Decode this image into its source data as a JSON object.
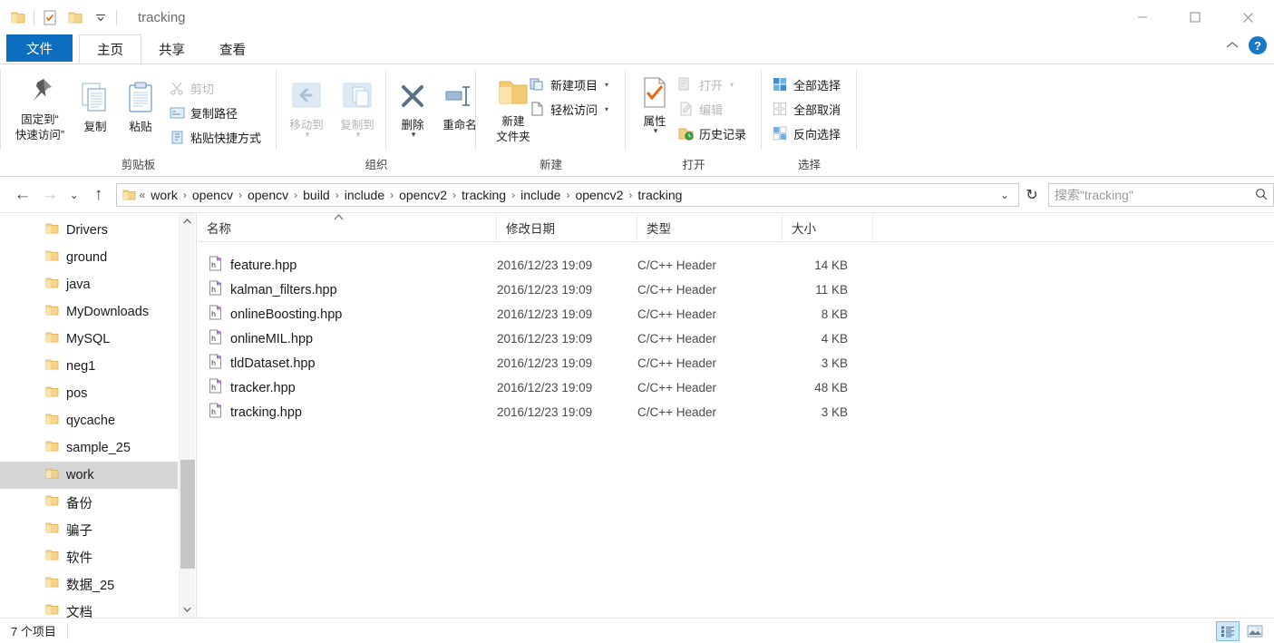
{
  "window": {
    "title": "tracking",
    "minimize_label": "最小化",
    "maximize_label": "最大化",
    "close_label": "关闭"
  },
  "quick_access": {
    "items": [
      {
        "name": "folder-icon",
        "label": "属性"
      },
      {
        "name": "properties-icon",
        "label": "属性"
      },
      {
        "name": "new-folder-icon",
        "label": "新建文件夹"
      },
      {
        "name": "customize-icon",
        "label": "自定义快速访问工具栏"
      }
    ]
  },
  "tabs": [
    {
      "id": "file",
      "label": "文件",
      "state": "file"
    },
    {
      "id": "home",
      "label": "主页",
      "state": "active"
    },
    {
      "id": "share",
      "label": "共享",
      "state": "normal"
    },
    {
      "id": "view",
      "label": "查看",
      "state": "normal"
    }
  ],
  "ribbon_right": {
    "collapse_label": "⌃",
    "help_label": "?"
  },
  "ribbon": {
    "groups": [
      {
        "id": "clipboard",
        "label": "剪贴板",
        "big": [
          {
            "name": "pin-to-quick-access-button",
            "icon": "pin-icon",
            "label": "固定到“\n快速访问”",
            "line1": "固定到“",
            "line2": "快速访问”",
            "dim": false
          },
          {
            "name": "copy-button",
            "icon": "copy-icon",
            "label": "复制",
            "dim": false
          },
          {
            "name": "paste-button",
            "icon": "paste-icon",
            "label": "粘贴",
            "dim": false
          }
        ],
        "small": [
          {
            "name": "cut-button",
            "icon": "scissors-icon",
            "label": "剪切",
            "dim": true
          },
          {
            "name": "copy-path-button",
            "icon": "copy-path-icon",
            "label": "复制路径",
            "dim": false
          },
          {
            "name": "paste-shortcut-button",
            "icon": "paste-shortcut-icon",
            "label": "粘贴快捷方式",
            "dim": false
          }
        ]
      },
      {
        "id": "organize",
        "label": "组织",
        "big": [
          {
            "name": "move-to-button",
            "icon": "move-to-icon",
            "label": "移动到",
            "dim": true
          },
          {
            "name": "copy-to-button",
            "icon": "copy-to-icon",
            "label": "复制到",
            "dim": true
          },
          {
            "name": "delete-button",
            "icon": "delete-icon",
            "label": "删除",
            "dim": false
          },
          {
            "name": "rename-button",
            "icon": "rename-icon",
            "label": "重命名",
            "dim": false
          }
        ],
        "small": []
      },
      {
        "id": "new",
        "label": "新建",
        "big": [
          {
            "name": "new-folder-button",
            "icon": "new-folder-icon",
            "line1": "新建",
            "line2": "文件夹",
            "label": "新建文件夹",
            "dim": false
          }
        ],
        "small": [
          {
            "name": "new-item-button",
            "icon": "new-item-icon",
            "label": "新建项目",
            "dim": false,
            "caret": true
          },
          {
            "name": "easy-access-button",
            "icon": "easy-access-icon",
            "label": "轻松访问",
            "dim": false,
            "caret": true
          }
        ]
      },
      {
        "id": "open",
        "label": "打开",
        "big": [
          {
            "name": "properties-button",
            "icon": "properties-icon",
            "label": "属性",
            "dim": false
          }
        ],
        "small": [
          {
            "name": "open-button",
            "icon": "open-icon",
            "label": "打开",
            "dim": true,
            "caret": true
          },
          {
            "name": "edit-button",
            "icon": "edit-icon",
            "label": "编辑",
            "dim": true
          },
          {
            "name": "history-button",
            "icon": "history-icon",
            "label": "历史记录",
            "dim": false
          }
        ]
      },
      {
        "id": "select",
        "label": "选择",
        "big": [],
        "small": [
          {
            "name": "select-all-button",
            "icon": "select-all-icon",
            "label": "全部选择",
            "dim": false
          },
          {
            "name": "select-none-button",
            "icon": "select-none-icon",
            "label": "全部取消",
            "dim": false
          },
          {
            "name": "invert-selection-button",
            "icon": "invert-selection-icon",
            "label": "反向选择",
            "dim": false
          }
        ]
      }
    ]
  },
  "nav": {
    "back_label": "←",
    "forward_label": "→",
    "recent_label": "⌄",
    "up_label": "↑",
    "overflow_label": "«",
    "breadcrumbs": [
      "work",
      "opencv",
      "opencv",
      "build",
      "include",
      "opencv2",
      "tracking",
      "include",
      "opencv2",
      "tracking"
    ],
    "separator": "›",
    "dropdown_label": "⌄",
    "refresh_label": "↻"
  },
  "search": {
    "placeholder": "搜索\"tracking\"",
    "icon": "search-icon"
  },
  "sidebar": {
    "items": [
      {
        "label": "Drivers",
        "selected": false
      },
      {
        "label": "ground",
        "selected": false
      },
      {
        "label": "java",
        "selected": false
      },
      {
        "label": "MyDownloads",
        "selected": false
      },
      {
        "label": "MySQL",
        "selected": false
      },
      {
        "label": "neg1",
        "selected": false
      },
      {
        "label": "pos",
        "selected": false
      },
      {
        "label": "qycache",
        "selected": false
      },
      {
        "label": "sample_25",
        "selected": false
      },
      {
        "label": "work",
        "selected": true
      },
      {
        "label": "备份",
        "selected": false
      },
      {
        "label": "骗子",
        "selected": false
      },
      {
        "label": "软件",
        "selected": false
      },
      {
        "label": "数据_25",
        "selected": false
      },
      {
        "label": "文档",
        "selected": false
      }
    ]
  },
  "filelist": {
    "columns": [
      {
        "id": "name",
        "label": "名称",
        "sorted": true,
        "sort_dir": "asc"
      },
      {
        "id": "date",
        "label": "修改日期",
        "sorted": false
      },
      {
        "id": "type",
        "label": "类型",
        "sorted": false
      },
      {
        "id": "size",
        "label": "大小",
        "sorted": false
      }
    ],
    "rows": [
      {
        "name": "feature.hpp",
        "date": "2016/12/23 19:09",
        "type": "C/C++ Header",
        "size": "14 KB",
        "icon": "hpp-file-icon"
      },
      {
        "name": "kalman_filters.hpp",
        "date": "2016/12/23 19:09",
        "type": "C/C++ Header",
        "size": "11 KB",
        "icon": "hpp-file-icon"
      },
      {
        "name": "onlineBoosting.hpp",
        "date": "2016/12/23 19:09",
        "type": "C/C++ Header",
        "size": "8 KB",
        "icon": "hpp-file-icon"
      },
      {
        "name": "onlineMIL.hpp",
        "date": "2016/12/23 19:09",
        "type": "C/C++ Header",
        "size": "4 KB",
        "icon": "hpp-file-icon"
      },
      {
        "name": "tldDataset.hpp",
        "date": "2016/12/23 19:09",
        "type": "C/C++ Header",
        "size": "3 KB",
        "icon": "hpp-file-icon"
      },
      {
        "name": "tracker.hpp",
        "date": "2016/12/23 19:09",
        "type": "C/C++ Header",
        "size": "48 KB",
        "icon": "hpp-file-icon"
      },
      {
        "name": "tracking.hpp",
        "date": "2016/12/23 19:09",
        "type": "C/C++ Header",
        "size": "3 KB",
        "icon": "hpp-file-icon"
      }
    ]
  },
  "statusbar": {
    "item_count": "7 个项目",
    "details_view_label": "详细信息",
    "thumbnail_view_label": "大图标"
  },
  "colors": {
    "accent": "#0d6ebf",
    "folder": "#f3c96b",
    "selection": "#d6d6d6",
    "help_blue": "#1878c8"
  }
}
